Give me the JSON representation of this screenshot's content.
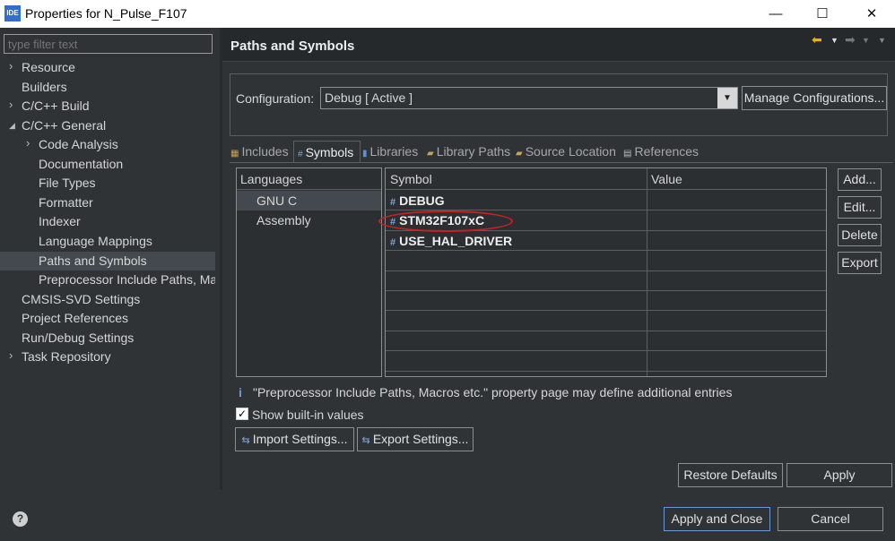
{
  "window": {
    "app_icon": "IDE",
    "title": "Properties for N_Pulse_F107",
    "minimize": "—",
    "maximize": "☐",
    "close": "✕"
  },
  "filter": {
    "placeholder": "type filter text"
  },
  "tree": [
    {
      "label": "Resource",
      "expandable": true,
      "indent": 0
    },
    {
      "label": "Builders",
      "expandable": false,
      "indent": 0
    },
    {
      "label": "C/C++ Build",
      "expandable": true,
      "indent": 0
    },
    {
      "label": "C/C++ General",
      "expandable": true,
      "expanded": true,
      "indent": 0
    },
    {
      "label": "Code Analysis",
      "expandable": true,
      "indent": 1
    },
    {
      "label": "Documentation",
      "expandable": false,
      "indent": 1
    },
    {
      "label": "File Types",
      "expandable": false,
      "indent": 1
    },
    {
      "label": "Formatter",
      "expandable": false,
      "indent": 1
    },
    {
      "label": "Indexer",
      "expandable": false,
      "indent": 1
    },
    {
      "label": "Language Mappings",
      "expandable": false,
      "indent": 1
    },
    {
      "label": "Paths and Symbols",
      "expandable": false,
      "indent": 1,
      "selected": true
    },
    {
      "label": "Preprocessor Include Paths, Mac",
      "expandable": false,
      "indent": 1
    },
    {
      "label": "CMSIS-SVD Settings",
      "expandable": false,
      "indent": 0
    },
    {
      "label": "Project References",
      "expandable": false,
      "indent": 0
    },
    {
      "label": "Run/Debug Settings",
      "expandable": false,
      "indent": 0
    },
    {
      "label": "Task Repository",
      "expandable": true,
      "indent": 0
    }
  ],
  "page": {
    "title": "Paths and Symbols"
  },
  "nav_icons": [
    "back-arrow-icon",
    "forward-arrow-icon",
    "menu-chevron-icon"
  ],
  "configuration": {
    "label": "Configuration:",
    "value": "Debug  [ Active ]",
    "manage_button": "Manage Configurations..."
  },
  "tabs": [
    {
      "label": "Includes",
      "icon": "includes-icon"
    },
    {
      "label": "Symbols",
      "icon": "symbols-icon",
      "active": true
    },
    {
      "label": "Libraries",
      "icon": "libraries-icon"
    },
    {
      "label": "Library Paths",
      "icon": "library-paths-icon"
    },
    {
      "label": "Source Location",
      "icon": "source-location-icon"
    },
    {
      "label": "References",
      "icon": "references-icon"
    }
  ],
  "languages": {
    "header": "Languages",
    "items": [
      {
        "label": "GNU C",
        "selected": true
      },
      {
        "label": "Assembly",
        "selected": false
      }
    ]
  },
  "symbols": {
    "columns": [
      "Symbol",
      "Value"
    ],
    "rows": [
      {
        "symbol": "DEBUG",
        "value": ""
      },
      {
        "symbol": "STM32F107xC",
        "value": ""
      },
      {
        "symbol": "USE_HAL_DRIVER",
        "value": ""
      }
    ],
    "highlight_color": "#cc2020"
  },
  "side_buttons": [
    "Add...",
    "Edit...",
    "Delete",
    "Export"
  ],
  "info_text": "\"Preprocessor Include Paths, Macros etc.\" property page may define additional entries",
  "show_builtin": {
    "label": "Show built-in values",
    "checked": true
  },
  "import_button": "Import Settings...",
  "export_button": "Export Settings...",
  "restore_defaults": "Restore Defaults",
  "apply": "Apply",
  "apply_and_close": "Apply and Close",
  "cancel": "Cancel",
  "help": "?"
}
